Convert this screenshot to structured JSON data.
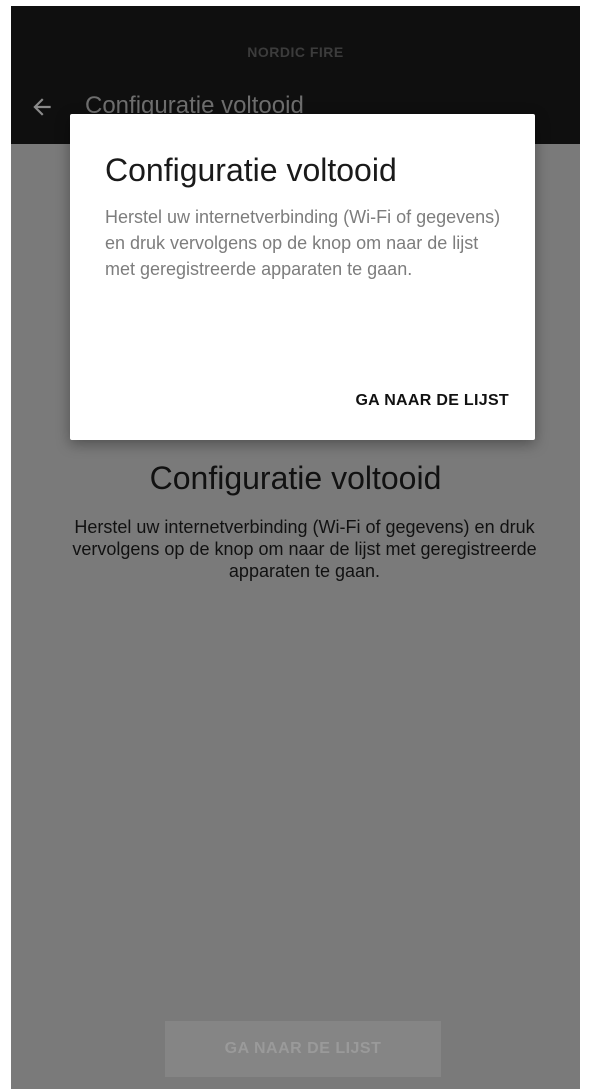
{
  "app": {
    "brand": "NORDIC FIRE",
    "title": "Configuratie voltooid"
  },
  "main": {
    "title": "Configuratie voltooid",
    "message": "Herstel uw internetverbinding (Wi-Fi of gegevens) en druk vervolgens op de knop om naar de lijst met geregistreerde apparaten te gaan.",
    "button_label": "GA NAAR DE LIJST"
  },
  "dialog": {
    "title": "Configuratie voltooid",
    "message": "Herstel uw internetverbinding (Wi-Fi of gegevens) en druk vervolgens op de knop om naar de lijst met geregistreerde apparaten te gaan.",
    "button_label": "GA NAAR DE LIJST"
  },
  "icons": {
    "back": "arrow-left"
  },
  "colors": {
    "appbar": "#0f0f0f",
    "scrim_background": "#7a7a7a",
    "dialog_background": "#ffffff",
    "dialog_message": "#7d7d7d"
  }
}
